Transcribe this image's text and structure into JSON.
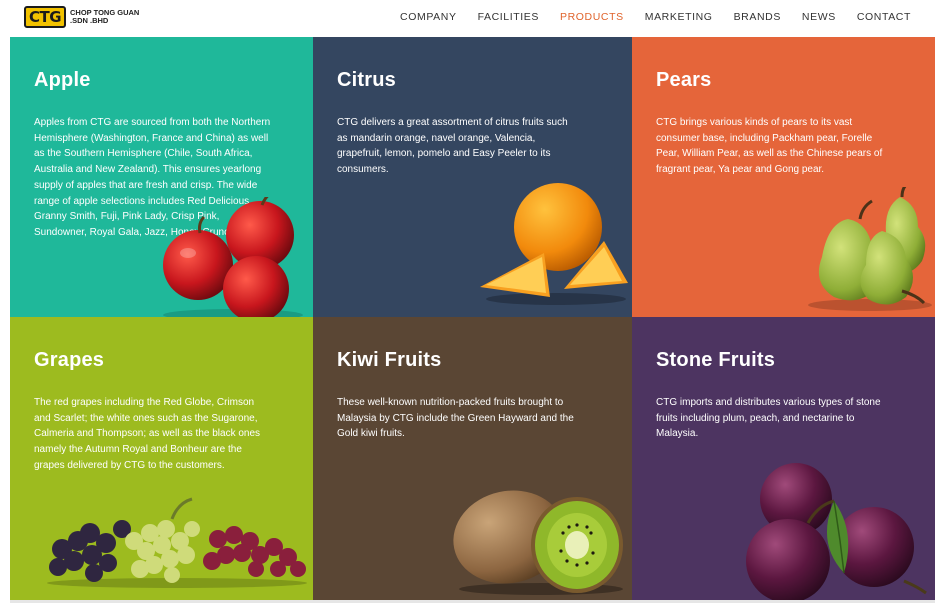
{
  "brand": {
    "logo_text": "CTG",
    "company_line1": "CHOP TONG GUAN",
    "company_line2": ".SDN .BHD"
  },
  "nav": {
    "items": [
      "COMPANY",
      "FACILITIES",
      "PRODUCTS",
      "MARKETING",
      "BRANDS",
      "NEWS",
      "CONTACT"
    ],
    "active": "PRODUCTS",
    "active_color": "#e0632b"
  },
  "products": [
    {
      "title": "Apple",
      "color": "#1fb89a",
      "description": "Apples from CTG are sourced from both the Northern Hemisphere (Washington, France and China) as well as the Southern Hemisphere (Chile, South Africa, Australia and New Zealand). This ensures yearlong supply of apples that are fresh and crisp. The wide range of apple selections includes Red Delicious, Granny Smith, Fuji, Pink Lady, Crisp Pink, Sundowner, Royal Gala, Jazz, Honey Crunch, etc.",
      "image": "apple-image"
    },
    {
      "title": "Citrus",
      "color": "#344660",
      "description": "CTG delivers a great assortment of citrus fruits such as mandarin orange, navel orange, Valencia, grapefruit, lemon, pomelo and Easy Peeler to its consumers.",
      "image": "orange-image"
    },
    {
      "title": "Pears",
      "color": "#e5653a",
      "description": "CTG brings various kinds of pears to its vast consumer base, including Packham pear, Forelle Pear, William Pear, as well as the Chinese pears of fragrant pear, Ya pear and Gong pear.",
      "image": "pear-image"
    },
    {
      "title": "Grapes",
      "color": "#9dbb1f",
      "description": "The red grapes including the Red Globe, Crimson and Scarlet; the white ones such as the Sugarone, Calmeria and Thompson; as well as the black ones namely the Autumn Royal and Bonheur are the grapes delivered by CTG to the customers.",
      "image": "grapes-image"
    },
    {
      "title": "Kiwi Fruits",
      "color": "#5a4634",
      "description": "These well-known nutrition-packed fruits brought to Malaysia by CTG include the Green Hayward and the Gold kiwi fruits.",
      "image": "kiwi-image"
    },
    {
      "title": "Stone Fruits",
      "color": "#4d3461",
      "description": "CTG imports and distributes various types of stone fruits including plum, peach, and nectarine to Malaysia.",
      "image": "plum-image"
    }
  ]
}
